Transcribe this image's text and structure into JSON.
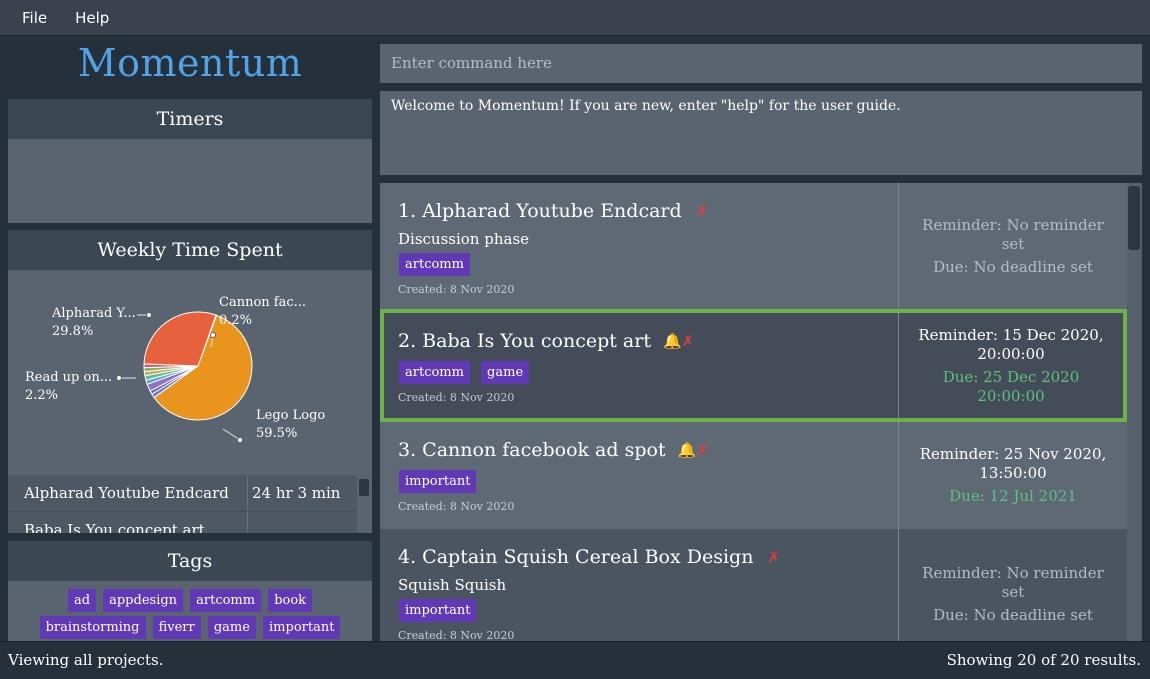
{
  "menu": {
    "file": "File",
    "help": "Help"
  },
  "app_title": "Momentum",
  "timers": {
    "title": "Timers"
  },
  "weekly": {
    "title": "Weekly Time Spent",
    "slices": [
      {
        "label": "Alpharad Y...",
        "percent": "29.8%",
        "color": "#e8613d"
      },
      {
        "label": "Cannon fac...",
        "percent": "0.2%",
        "color": "#9a8ad6"
      },
      {
        "label": "Read up on...",
        "percent": "2.2%",
        "color": "#8b73c9"
      },
      {
        "label": "Lego Logo",
        "percent": "59.5%",
        "color": "#e9951d"
      }
    ],
    "rows": [
      {
        "name": "Alpharad Youtube Endcard",
        "duration": "24 hr 3 min"
      },
      {
        "name": "Baba Is You concept art",
        "duration": ""
      }
    ]
  },
  "tags": {
    "title": "Tags",
    "items": [
      "ad",
      "appdesign",
      "artcomm",
      "book",
      "brainstorming",
      "fiverr",
      "game",
      "important"
    ]
  },
  "command": {
    "placeholder": "Enter command here"
  },
  "result": {
    "text": "Welcome to Momentum! If you are new, enter \"help\" for the user guide."
  },
  "projects": [
    {
      "title": "1. Alpharad Youtube Endcard",
      "description": "Discussion phase",
      "tags": [
        "artcomm"
      ],
      "created": "Created: 8 Nov 2020",
      "reminder": "Reminder: No reminder set",
      "due": "Due: No deadline set",
      "has_bell": false
    },
    {
      "title": "2. Baba Is You concept art",
      "description": "",
      "tags": [
        "artcomm",
        "game"
      ],
      "created": "Created: 8 Nov 2020",
      "reminder": "Reminder: 15 Dec 2020, 20:00:00",
      "due": "Due: 25 Dec 2020 20:00:00",
      "has_bell": true
    },
    {
      "title": "3. Cannon facebook ad spot",
      "description": "",
      "tags": [
        "important"
      ],
      "created": "Created: 8 Nov 2020",
      "reminder": "Reminder: 25 Nov 2020, 13:50:00",
      "due": "Due: 12 Jul 2021",
      "has_bell": true
    },
    {
      "title": "4. Captain Squish Cereal Box Design",
      "description": "Squish Squish",
      "tags": [
        "important"
      ],
      "created": "Created: 8 Nov 2020",
      "reminder": "Reminder: No reminder set",
      "due": "Due: No deadline set",
      "has_bell": false
    }
  ],
  "status": {
    "left": "Viewing all projects.",
    "right": "Showing 20 of 20 results."
  },
  "colors": {
    "accent": "#4fa3e6",
    "tag": "#6139b6",
    "selected_border": "#6cb34b",
    "due_green": "#5ac27b",
    "delete_red": "#e33d3d"
  },
  "icons": {
    "delete": "x-icon",
    "reminder": "bell-icon"
  }
}
